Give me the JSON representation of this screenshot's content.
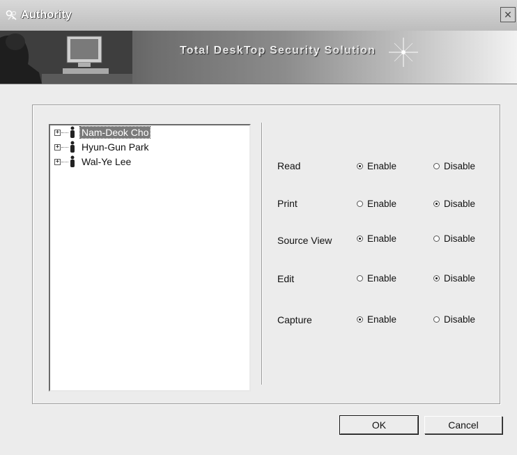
{
  "window": {
    "title": "Authority",
    "close_glyph": "✕"
  },
  "banner": {
    "title": "Total DeskTop Security Solution"
  },
  "users": [
    {
      "name": "Nam-Deok Cho",
      "selected": true
    },
    {
      "name": "Hyun-Gun Park",
      "selected": false
    },
    {
      "name": "Wal-Ye Lee",
      "selected": false
    }
  ],
  "permissions": [
    {
      "label": "Read",
      "enable": "Enable",
      "disable": "Disable",
      "value": "enable"
    },
    {
      "label": "Print",
      "enable": "Enable",
      "disable": "Disable",
      "value": "disable"
    },
    {
      "label": "Source View",
      "enable": "Enable",
      "disable": "Disable",
      "value": "enable"
    },
    {
      "label": "Edit",
      "enable": "Enable",
      "disable": "Disable",
      "value": "disable"
    },
    {
      "label": "Capture",
      "enable": "Enable",
      "disable": "Disable",
      "value": "enable"
    }
  ],
  "buttons": {
    "ok": "OK",
    "cancel": "Cancel"
  },
  "icons": {
    "window": "keys-icon",
    "tree_expander": "plus-box-icon",
    "user": "person-icon",
    "close": "close-icon"
  }
}
